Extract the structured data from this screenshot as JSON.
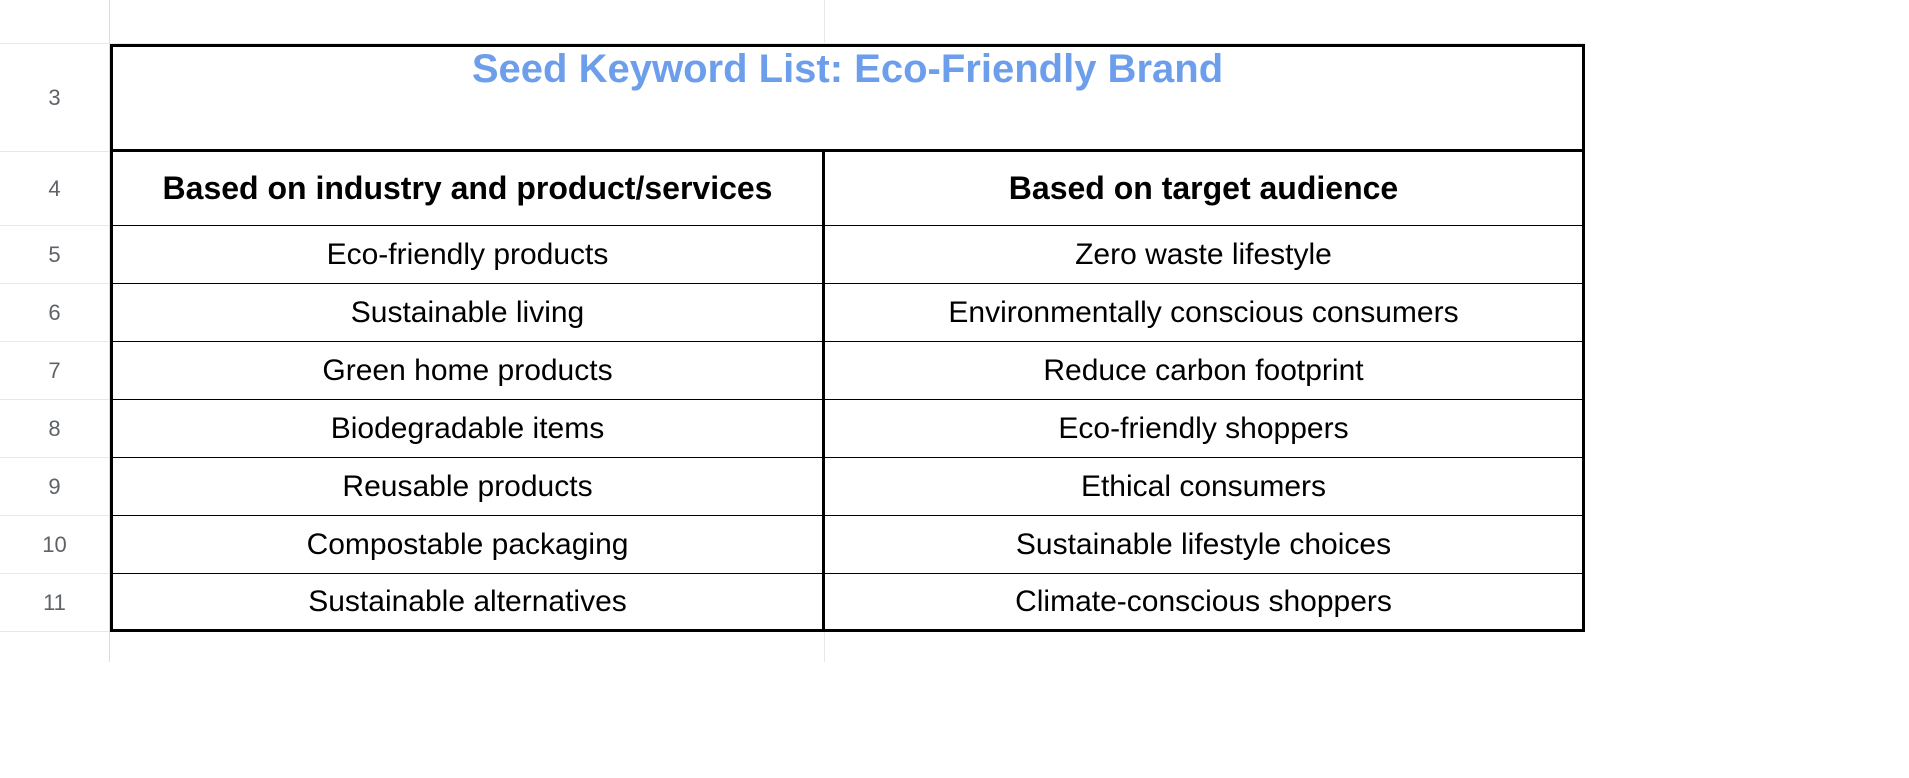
{
  "rows_numbers": {
    "title": "3",
    "header": "4",
    "data": [
      "5",
      "6",
      "7",
      "8",
      "9",
      "10",
      "11"
    ]
  },
  "title": "Seed Keyword List: Eco-Friendly Brand",
  "headers": {
    "colB": "Based on industry and product/services",
    "colC": "Based on target audience"
  },
  "data": [
    {
      "b": "Eco-friendly products",
      "c": "Zero waste lifestyle"
    },
    {
      "b": "Sustainable living",
      "c": "Environmentally conscious consumers"
    },
    {
      "b": "Green home products",
      "c": "Reduce carbon footprint"
    },
    {
      "b": "Biodegradable items",
      "c": "Eco-friendly shoppers"
    },
    {
      "b": "Reusable products",
      "c": "Ethical consumers"
    },
    {
      "b": "Compostable packaging",
      "c": "Sustainable lifestyle choices"
    },
    {
      "b": "Sustainable alternatives",
      "c": "Climate-conscious shoppers"
    }
  ],
  "chart_data": {
    "type": "table",
    "title": "Seed Keyword List: Eco-Friendly Brand",
    "columns": [
      "Based on industry and product/services",
      "Based on target audience"
    ],
    "rows": [
      [
        "Eco-friendly products",
        "Zero waste lifestyle"
      ],
      [
        "Sustainable living",
        "Environmentally conscious consumers"
      ],
      [
        "Green home products",
        "Reduce carbon footprint"
      ],
      [
        "Biodegradable items",
        "Eco-friendly shoppers"
      ],
      [
        "Reusable products",
        "Ethical consumers"
      ],
      [
        "Compostable packaging",
        "Sustainable lifestyle choices"
      ],
      [
        "Sustainable alternatives",
        "Climate-conscious shoppers"
      ]
    ]
  }
}
